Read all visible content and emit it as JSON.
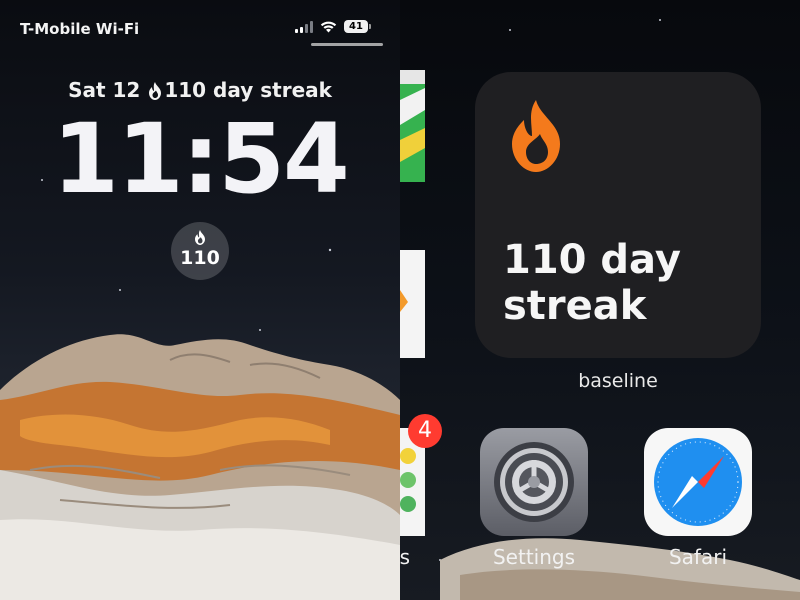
{
  "lock_screen": {
    "status_bar": {
      "carrier": "T-Mobile Wi-Fi",
      "battery": "41"
    },
    "date": "Sat 12",
    "streak_text": "110 day streak",
    "time": "11:54",
    "widget_value": "110"
  },
  "home_screen": {
    "streak_widget": {
      "text_line1": "110 day",
      "text_line2": "streak",
      "label": "baseline"
    },
    "badge_count": "4",
    "partial_label": "s",
    "apps": [
      {
        "name": "Settings"
      },
      {
        "name": "Safari"
      }
    ]
  },
  "colors": {
    "flame": "#f47a1c",
    "badge": "#ff3b30",
    "widget_bg": "#1f1f22"
  }
}
